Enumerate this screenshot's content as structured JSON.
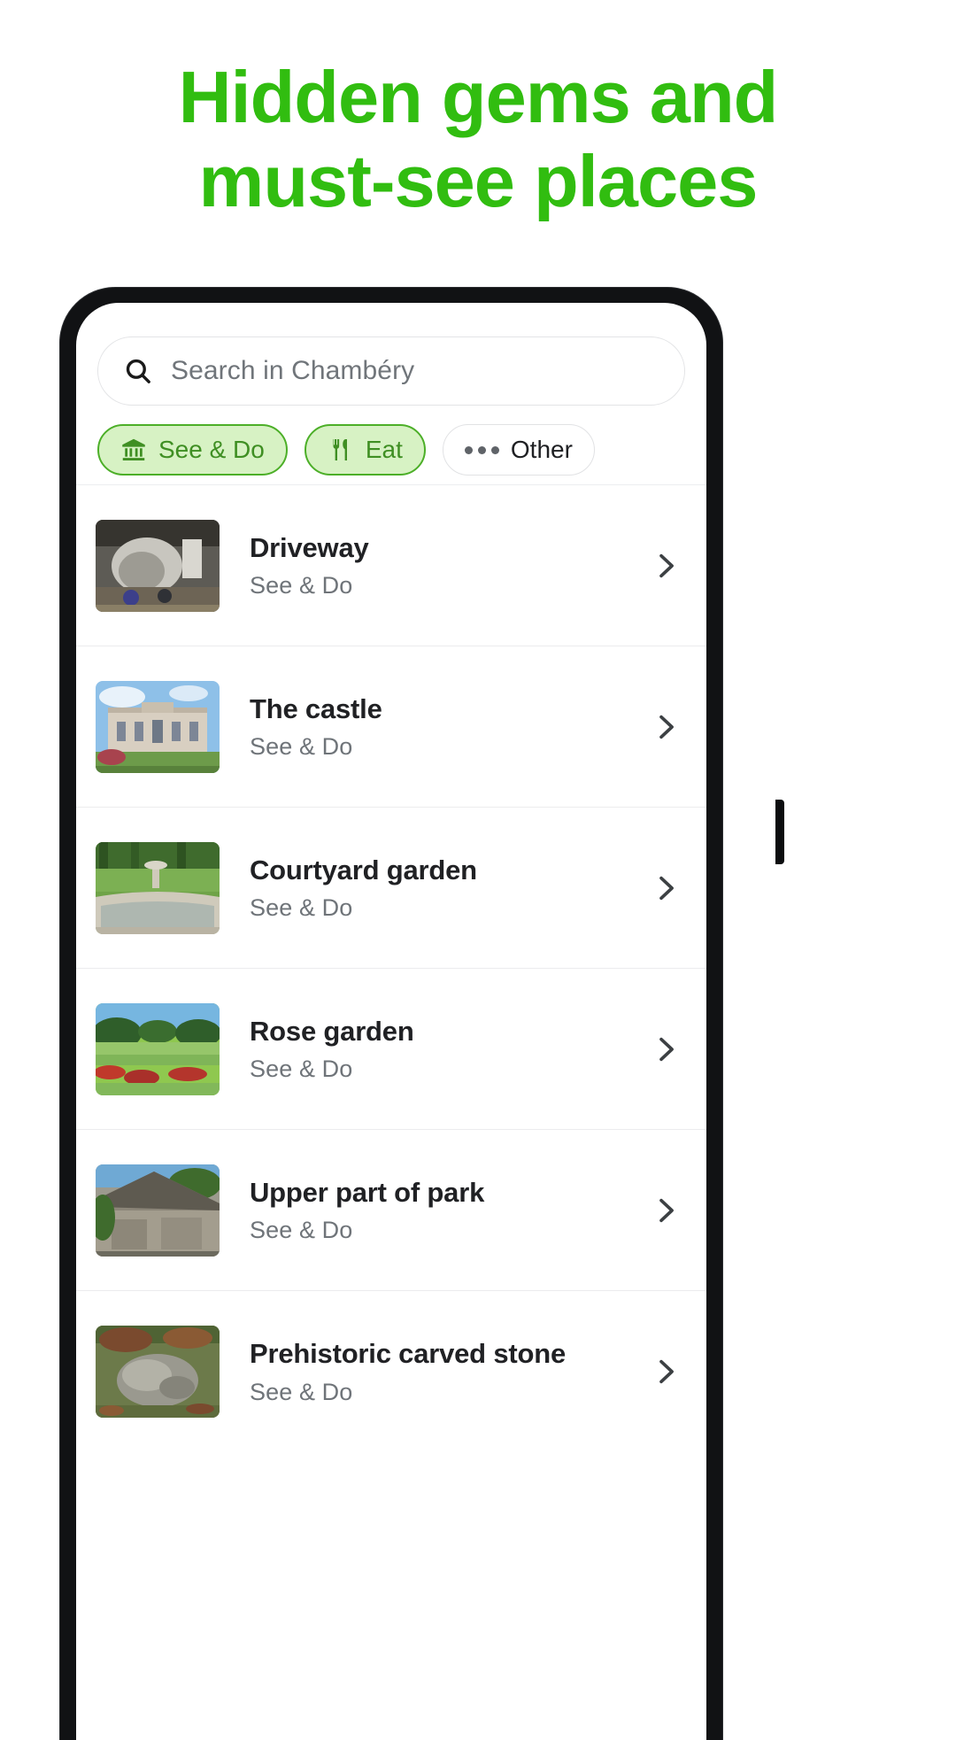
{
  "headline": {
    "line1": "Hidden gems and",
    "line2": "must-see places",
    "color": "#31bd10"
  },
  "search": {
    "icon": "search-icon",
    "placeholder": "Search in Chambéry",
    "value": ""
  },
  "filters": {
    "chips": [
      {
        "label": "See & Do",
        "icon": "museum-icon",
        "selected": true
      },
      {
        "label": "Eat",
        "icon": "restaurant-icon",
        "selected": true
      },
      {
        "label": "Other",
        "icon": "more-dots-icon",
        "selected": false
      }
    ],
    "accent": "#4caf28",
    "selected_bg": "#d7f2c4",
    "selected_text": "#3f8f23"
  },
  "list": {
    "items": [
      {
        "title": "Driveway",
        "category": "See & Do",
        "chevron": "chevron-right-icon",
        "thumb": "cave-rocks-photo"
      },
      {
        "title": "The castle",
        "category": "See & Do",
        "chevron": "chevron-right-icon",
        "thumb": "castle-photo"
      },
      {
        "title": "Courtyard garden",
        "category": "See & Do",
        "chevron": "chevron-right-icon",
        "thumb": "fountain-garden-photo"
      },
      {
        "title": "Rose garden",
        "category": "See & Do",
        "chevron": "chevron-right-icon",
        "thumb": "rose-garden-photo"
      },
      {
        "title": "Upper part of park",
        "category": "See & Do",
        "chevron": "chevron-right-icon",
        "thumb": "stone-hut-photo"
      },
      {
        "title": "Prehistoric carved stone",
        "category": "See & Do",
        "chevron": "chevron-right-icon",
        "thumb": "carved-stone-photo"
      }
    ]
  }
}
